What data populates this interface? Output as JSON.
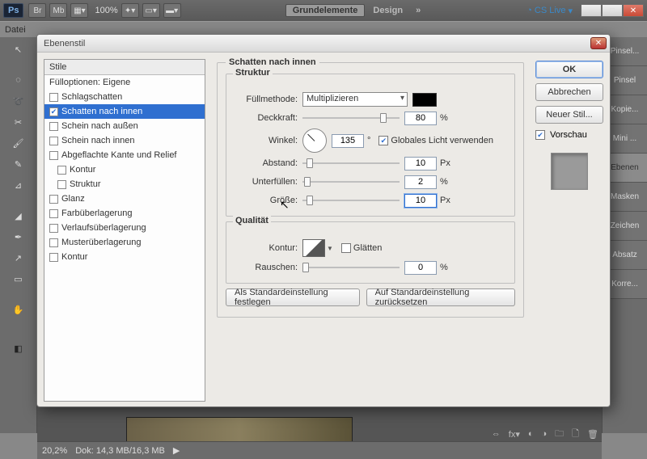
{
  "topbar": {
    "zoom": "100%",
    "essential": "Grundelemente",
    "design": "Design",
    "cslive": "CS Live"
  },
  "menubar": {
    "file": "Datei"
  },
  "statusbar": {
    "zoom": "20,2%",
    "docsize": "Dok: 14,3 MB/16,3 MB"
  },
  "panels": [
    "Pinsel...",
    "Pinsel",
    "Kopie...",
    "Mini ...",
    "Ebenen",
    "Masken",
    "Zeichen",
    "Absatz",
    "Korre..."
  ],
  "dialog": {
    "title": "Ebenenstil",
    "stylesHeader": "Stile",
    "fillOptions": "Fülloptionen: Eigene",
    "items": [
      {
        "label": "Schlagschatten",
        "checked": false
      },
      {
        "label": "Schatten nach innen",
        "checked": true,
        "selected": true
      },
      {
        "label": "Schein nach außen",
        "checked": false
      },
      {
        "label": "Schein nach innen",
        "checked": false
      },
      {
        "label": "Abgeflachte Kante und Relief",
        "checked": false,
        "noCb": true
      },
      {
        "label": "Kontur",
        "checked": false,
        "sub": true
      },
      {
        "label": "Struktur",
        "checked": false,
        "sub": true
      },
      {
        "label": "Glanz",
        "checked": false
      },
      {
        "label": "Farbüberlagerung",
        "checked": false
      },
      {
        "label": "Verlaufsüberlagerung",
        "checked": false
      },
      {
        "label": "Musterüberlagerung",
        "checked": false
      },
      {
        "label": "Kontur",
        "checked": false
      }
    ],
    "sectionTitle": "Schatten nach innen",
    "struct": {
      "legend": "Struktur",
      "blendLabel": "Füllmethode:",
      "blendValue": "Multiplizieren",
      "opacityLabel": "Deckkraft:",
      "opacityValue": "80",
      "opacityUnit": "%",
      "angleLabel": "Winkel:",
      "angleValue": "135",
      "angleUnit": "°",
      "globalLightLabel": "Globales Licht verwenden",
      "globalLightChecked": true,
      "distanceLabel": "Abstand:",
      "distanceValue": "10",
      "distanceUnit": "Px",
      "chokeLabel": "Unterfüllen:",
      "chokeValue": "2",
      "chokeUnit": "%",
      "sizeLabel": "Größe:",
      "sizeValue": "10",
      "sizeUnit": "Px"
    },
    "quality": {
      "legend": "Qualität",
      "contourLabel": "Kontur:",
      "antialiasLabel": "Glätten",
      "noiseLabel": "Rauschen:",
      "noiseValue": "0",
      "noiseUnit": "%"
    },
    "defaultBtn": "Als Standardeinstellung festlegen",
    "resetBtn": "Auf Standardeinstellung zurücksetzen",
    "ok": "OK",
    "cancel": "Abbrechen",
    "newStyle": "Neuer Stil...",
    "previewLabel": "Vorschau",
    "previewChecked": true
  }
}
